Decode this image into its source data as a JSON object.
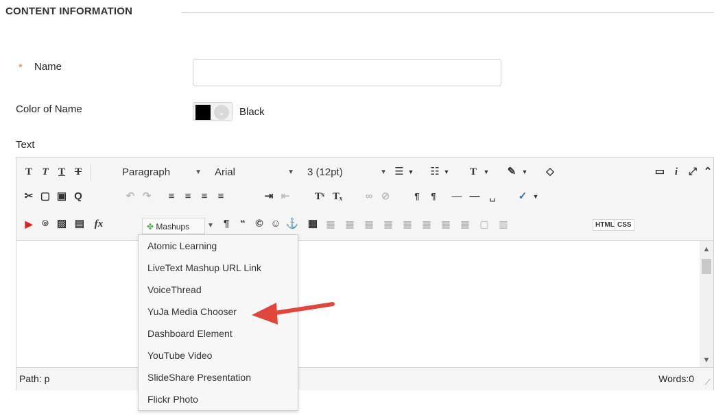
{
  "section": {
    "title": "CONTENT INFORMATION"
  },
  "form": {
    "name_label": "Name",
    "required_marker": "*",
    "name_value": "",
    "color_label": "Color of Name",
    "color_value": "Black",
    "color_swatch": "#000000",
    "text_label": "Text"
  },
  "toolbar": {
    "row1": {
      "bold_icon": "T",
      "italic_icon": "T",
      "underline_icon": "T",
      "strike_icon": "T",
      "paragraph_select": "Paragraph",
      "font_select": "Arial",
      "size_select": "3 (12pt)",
      "bullet_list_icon": "☰",
      "numbered_list_icon": "☷",
      "text_color_icon": "T",
      "highlight_icon": "✎",
      "eraser_icon": "◇",
      "preview_icon": "▭",
      "info_icon": "i",
      "fullscreen_icon": "⤢",
      "collapse_icon": "⌃"
    },
    "row2": {
      "cut_icon": "✂",
      "copy_icon": "▢",
      "paste_icon": "▣",
      "find_icon": "Q",
      "undo_icon": "↶",
      "redo_icon": "↷",
      "align_left_icon": "≡",
      "align_center_icon": "≡",
      "align_right_icon": "≡",
      "align_justify_icon": "≡",
      "indent_icon": "⇥",
      "outdent_icon": "⇤",
      "superscript_icon": "Tˣ",
      "subscript_icon": "Tₓ",
      "link_icon": "∞",
      "unlink_icon": "⊘",
      "ltr_icon": "¶",
      "rtl_icon": "¶",
      "hr_icon": "—",
      "hr2_icon": "—",
      "nbsp_icon": "␣",
      "spellcheck_icon": "✓"
    },
    "row3": {
      "youtube_icon": "▶",
      "attach_icon": "⌾",
      "image_icon": "▨",
      "media_icon": "▤",
      "math_icon": "fx",
      "mashups_label": "Mashups",
      "paragraph_mark_icon": "¶",
      "quote_icon": "“",
      "copyright_icon": "©",
      "emoji_icon": "☺",
      "anchor_icon": "⚓",
      "table_icon": "▦",
      "html_label": "HTML",
      "css_label": "CSS"
    }
  },
  "editor": {
    "path_label": "Path: p",
    "words_label": "Words:0"
  },
  "mashups_menu": [
    "Atomic Learning",
    "LiveText Mashup URL Link",
    "VoiceThread",
    "YuJa Media Chooser",
    "Dashboard Element",
    "YouTube Video",
    "SlideShare Presentation",
    "Flickr Photo"
  ],
  "colors": {
    "required": "#e67e22",
    "arrow": "#e0473c",
    "youtube": "#e02020"
  }
}
